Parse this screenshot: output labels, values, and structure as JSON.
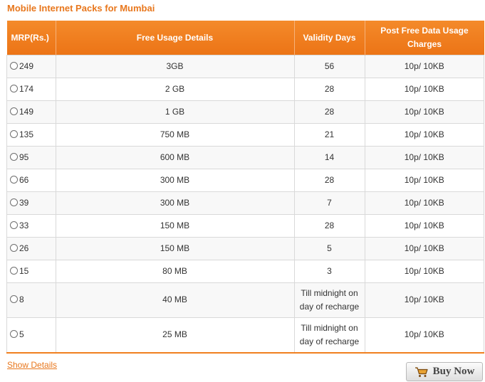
{
  "title": "Mobile Internet Packs for Mumbai",
  "headers": {
    "mrp": "MRP(Rs.)",
    "usage": "Free Usage Details",
    "validity": "Validity Days",
    "charges_line1": "Post Free Data Usage",
    "charges_line2": "Charges"
  },
  "rows": [
    {
      "mrp": "249",
      "usage": "3GB",
      "validity": "56",
      "charges": "10p/ 10KB"
    },
    {
      "mrp": "174",
      "usage": "2 GB",
      "validity": "28",
      "charges": "10p/ 10KB"
    },
    {
      "mrp": "149",
      "usage": "1 GB",
      "validity": "28",
      "charges": "10p/ 10KB"
    },
    {
      "mrp": "135",
      "usage": "750 MB",
      "validity": "21",
      "charges": "10p/ 10KB"
    },
    {
      "mrp": "95",
      "usage": "600 MB",
      "validity": "14",
      "charges": "10p/ 10KB"
    },
    {
      "mrp": "66",
      "usage": "300 MB",
      "validity": "28",
      "charges": "10p/ 10KB"
    },
    {
      "mrp": "39",
      "usage": "300 MB",
      "validity": "7",
      "charges": "10p/ 10KB"
    },
    {
      "mrp": "33",
      "usage": "150 MB",
      "validity": "28",
      "charges": "10p/ 10KB"
    },
    {
      "mrp": "26",
      "usage": "150 MB",
      "validity": "5",
      "charges": "10p/ 10KB"
    },
    {
      "mrp": "15",
      "usage": "80 MB",
      "validity": "3",
      "charges": "10p/ 10KB"
    },
    {
      "mrp": "8",
      "usage": "40 MB",
      "validity_line1": "Till midnight on",
      "validity_line2": "day of recharge",
      "charges": "10p/ 10KB"
    },
    {
      "mrp": "5",
      "usage": "25 MB",
      "validity_line1": "Till midnight on",
      "validity_line2": "day of recharge",
      "charges": "10p/ 10KB"
    }
  ],
  "links": {
    "show_details": "Show Details"
  },
  "buy_button": {
    "label": "Buy Now",
    "icon": "shopping-cart-icon"
  },
  "colors": {
    "accent": "#f07f1f",
    "title": "#e8771d"
  }
}
